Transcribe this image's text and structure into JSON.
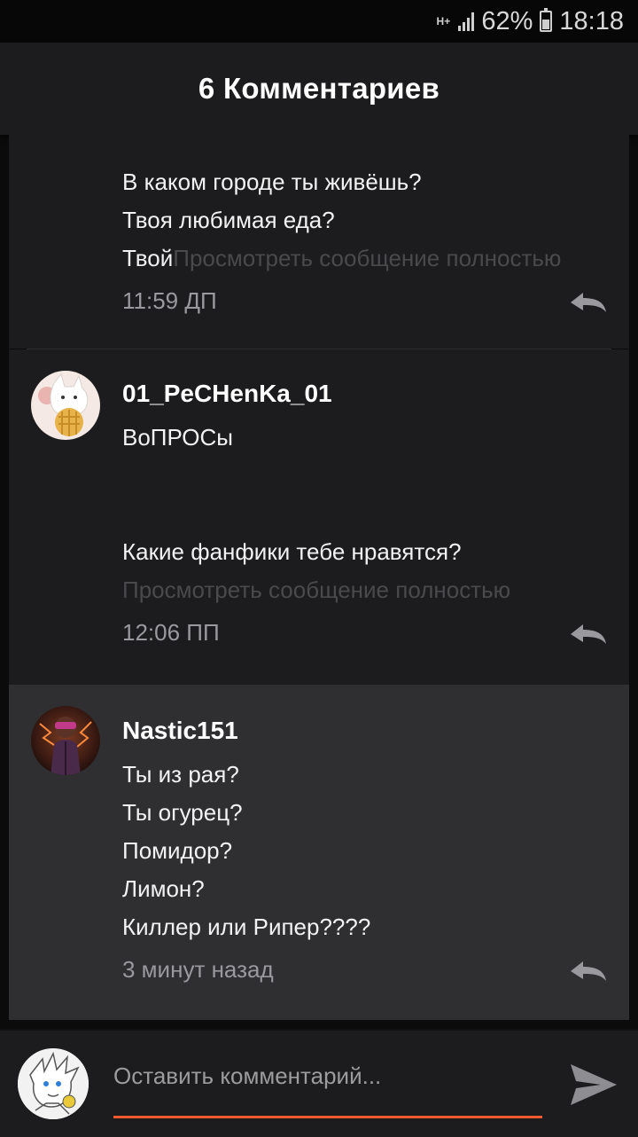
{
  "status_bar": {
    "network": "H+",
    "battery": "62%",
    "battery_level": 0.62,
    "time": "18:18"
  },
  "header": {
    "title": "6 Комментариев"
  },
  "comments": [
    {
      "lines": [
        " В каком городе ты живёшь?",
        "Твоя любимая еда?",
        "Твой"
      ],
      "more": "Просмотреть сообщение полностью",
      "time": "11:59 ДП"
    },
    {
      "username": "01_PeCHenKa_01",
      "lines": [
        "ВоПРОСы",
        "",
        "",
        "Какие фанфики тебе нравятся?"
      ],
      "more": "Просмотреть сообщение полностью",
      "time": "12:06 ПП"
    },
    {
      "username": "Nastic151",
      "lines": [
        "Ты из рая?",
        "Ты огурец?",
        "Помидор?",
        "Лимон?",
        "Киллер или Рипер????"
      ],
      "time": "3 минут назад"
    }
  ],
  "composer": {
    "placeholder": "Оставить комментарий...",
    "accent_color": "#ef5a2f"
  },
  "icons": [
    "reply-icon",
    "send-icon",
    "signal-icon",
    "battery-icon"
  ]
}
